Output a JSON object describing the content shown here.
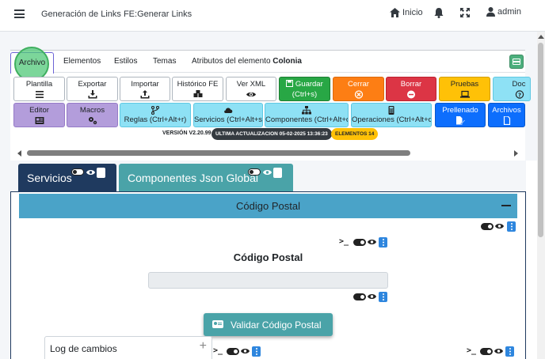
{
  "topbar": {
    "title": "Generación de Links FE:Generar Links",
    "home_label": "Inicio",
    "user_label": "admin"
  },
  "tabs": [
    {
      "label": "Archivo",
      "active": true
    },
    {
      "label": "Elementos"
    },
    {
      "label": "Estilos"
    },
    {
      "label": "Temas"
    },
    {
      "label": "Atributos del elemento",
      "bold": "Colonia"
    }
  ],
  "toolbar_row1": [
    {
      "label": "Plantilla",
      "icon": "list-icon",
      "color": "white"
    },
    {
      "label": "Exportar",
      "icon": "download-icon",
      "color": "white"
    },
    {
      "label": "Importar",
      "icon": "upload-icon",
      "color": "white"
    },
    {
      "label": "Histórico FE",
      "icon": "boxes-icon",
      "color": "white"
    },
    {
      "label": "Ver XML",
      "icon": "eye-icon",
      "color": "white"
    },
    {
      "label": "Guardar",
      "sub": "(Ctrl+s)",
      "icon": "save-icon",
      "color": "green"
    },
    {
      "label": "Cerrar",
      "icon": "close-circle-icon",
      "color": "orange"
    },
    {
      "label": "Borrar",
      "icon": "minus-circle-icon",
      "color": "red"
    },
    {
      "label": "Pruebas",
      "icon": "laptop-icon",
      "color": "yellow"
    },
    {
      "label": "Doc",
      "icon": "question-icon",
      "color": "cyan"
    }
  ],
  "toolbar_row2": [
    {
      "label": "Editor",
      "icon": "newspaper-icon",
      "color": "purple"
    },
    {
      "label": "Macros",
      "icon": "cogs-icon",
      "color": "purple"
    },
    {
      "label": "Reglas (Ctrl+Alt+r)",
      "icon": "branch-icon",
      "color": "cyan"
    },
    {
      "label": "Servicios (Ctrl+Alt+s)",
      "icon": "cloud-icon",
      "color": "cyan"
    },
    {
      "label": "Componentes (Ctrl+Alt+c)",
      "icon": "sitemap-icon",
      "color": "cyan"
    },
    {
      "label": "Operaciones (Ctrl+Alt+o)",
      "icon": "calculator-icon",
      "color": "cyan"
    },
    {
      "label": "Prellenado",
      "icon": "file-edit-icon",
      "color": "blue"
    },
    {
      "label": "Archivos",
      "icon": "file-icon",
      "color": "blue"
    }
  ],
  "version": {
    "text": "VERSIÓN V2.20.99",
    "last_update": "ULTIMA ACTUALIZACION 05-02-2025 13:36:23",
    "elements": "ELEMENTOS 14"
  },
  "content_tabs": {
    "servicios": "Servicios",
    "componentes": "Componentes Json Global"
  },
  "panel": {
    "header": "Código Postal",
    "field_title": "Código Postal",
    "validate_label": "Validar Código Postal",
    "terminal_symbol": ">_"
  },
  "log": {
    "label": "Log de cambios",
    "plus": "+"
  },
  "colors": {
    "accent_dark": "#1f3a5f",
    "accent_teal": "#4aa3a8",
    "header_blue": "#4aa3c8",
    "highlight": "#50c878"
  }
}
